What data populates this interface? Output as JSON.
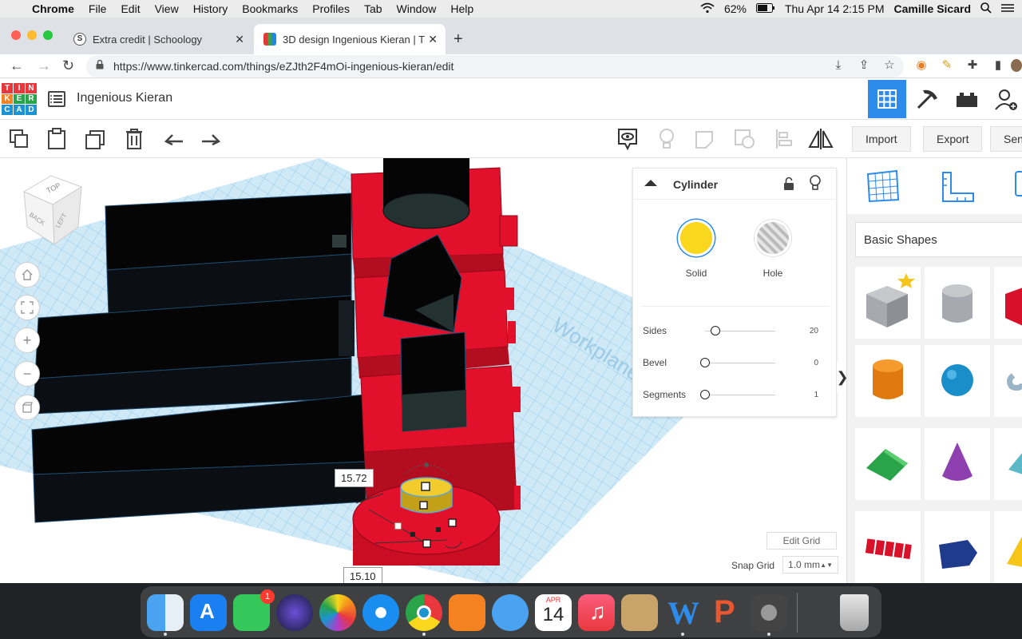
{
  "menubar": {
    "app": "Chrome",
    "items": [
      "File",
      "Edit",
      "View",
      "History",
      "Bookmarks",
      "Profiles",
      "Tab",
      "Window",
      "Help"
    ],
    "battery": "62%",
    "datetime": "Thu Apr 14  2:15 PM",
    "user": "Camille Sicard"
  },
  "tabs": [
    {
      "title": "Extra credit | Schoology"
    },
    {
      "title": "3D design Ingenious Kieran | T"
    }
  ],
  "url": "https://www.tinkercad.com/things/eZJth2F4mOi-ingenious-kieran/edit",
  "logo": {
    "letters": [
      "T",
      "I",
      "N",
      "K",
      "E",
      "R",
      "C",
      "A",
      "D"
    ]
  },
  "project": {
    "title": "Ingenious Kieran"
  },
  "toolbar": {
    "import": "Import",
    "export": "Export",
    "send": "Sen"
  },
  "viewcube": {
    "top": "TOP",
    "back": "BACK",
    "left": "LEFT"
  },
  "workplane_label": "Workplane",
  "dimensions": {
    "a": "15.72",
    "b": "15.10"
  },
  "inspector": {
    "title": "Cylinder",
    "solid": "Solid",
    "hole": "Hole",
    "solid_color": "#f9d71c",
    "params": [
      {
        "label": "Sides",
        "value": "20"
      },
      {
        "label": "Bevel",
        "value": "0"
      },
      {
        "label": "Segments",
        "value": "1"
      }
    ]
  },
  "grid": {
    "edit": "Edit Grid",
    "snap_label": "Snap Grid",
    "snap_value": "1.0 mm"
  },
  "library": {
    "category": "Basic Shapes"
  },
  "dock": {
    "calendar_month": "APR",
    "calendar_day": "14",
    "facetime_badge": "1"
  }
}
